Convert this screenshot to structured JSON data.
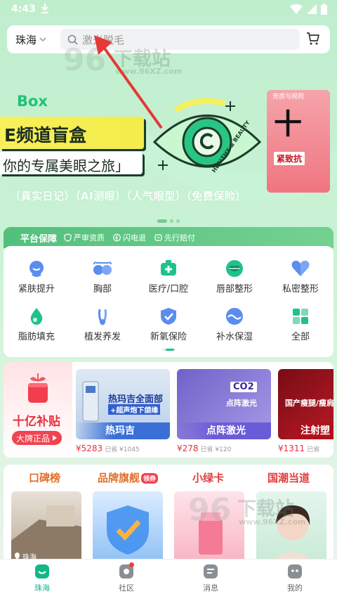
{
  "status": {
    "time": "4:43"
  },
  "header": {
    "city": "珠海",
    "search_placeholder": "激光脱毛"
  },
  "banner": {
    "box_word": "Box",
    "title": "E频道盲盒",
    "subtitle": "你的专属美眼之旅」",
    "tags": "`（真实日记）（AI测眼）（人气眼型）（免费保险）",
    "eye_caption": "HEALTHY & BEAUTY",
    "side_card": {
      "caption": "资质与规则",
      "big_text": "十",
      "tag": "紧致抗"
    }
  },
  "cert": {
    "title": "平台保障",
    "items": [
      "严审资质",
      "闪电退",
      "先行赔付"
    ]
  },
  "categories": [
    {
      "label": "紧肤提升",
      "icon": "face-lift-icon"
    },
    {
      "label": "胸部",
      "icon": "chest-icon"
    },
    {
      "label": "医疗/口腔",
      "icon": "medical-kit-icon"
    },
    {
      "label": "唇部整形",
      "icon": "lips-icon"
    },
    {
      "label": "私密整形",
      "icon": "heart-icon"
    },
    {
      "label": "脂肪填充",
      "icon": "drop-icon"
    },
    {
      "label": "植发养发",
      "icon": "hair-icon"
    },
    {
      "label": "新氧保险",
      "icon": "insurance-icon"
    },
    {
      "label": "补水保湿",
      "icon": "water-icon"
    },
    {
      "label": "全部",
      "icon": "grid-icon"
    }
  ],
  "subsidy": {
    "title": "十亿补贴",
    "badge": "大牌正品",
    "products": [
      {
        "name": "热玛吉",
        "overlay_line1": "热玛吉全面部",
        "overlay_line2": "+超声炮下颌缘",
        "price": "¥5283",
        "sold": "已省 ¥1045"
      },
      {
        "name": "点阵激光",
        "overlay_line1": "CO2",
        "overlay_line2": "点阵激光",
        "price": "¥278",
        "sold": "已省 ¥120"
      },
      {
        "name": "注射塑",
        "overlay_line1": "国产瘦腿/瘦肩",
        "overlay_line2": "",
        "price": "¥1311",
        "sold": "已省"
      }
    ]
  },
  "rankings": {
    "titles": [
      "口碑榜",
      "品牌旗舰",
      "小绿卡",
      "国潮当道"
    ],
    "new_badge": "领券",
    "location": "珠海"
  },
  "nav": [
    {
      "label": "珠海",
      "icon": "home-icon",
      "active": true
    },
    {
      "label": "社区",
      "icon": "community-icon",
      "active": false
    },
    {
      "label": "消息",
      "icon": "message-icon",
      "active": false
    },
    {
      "label": "我的",
      "icon": "profile-icon",
      "active": false
    }
  ],
  "watermark": {
    "brand": "下载站",
    "url": "www.96XZ.com",
    "num": "96"
  }
}
